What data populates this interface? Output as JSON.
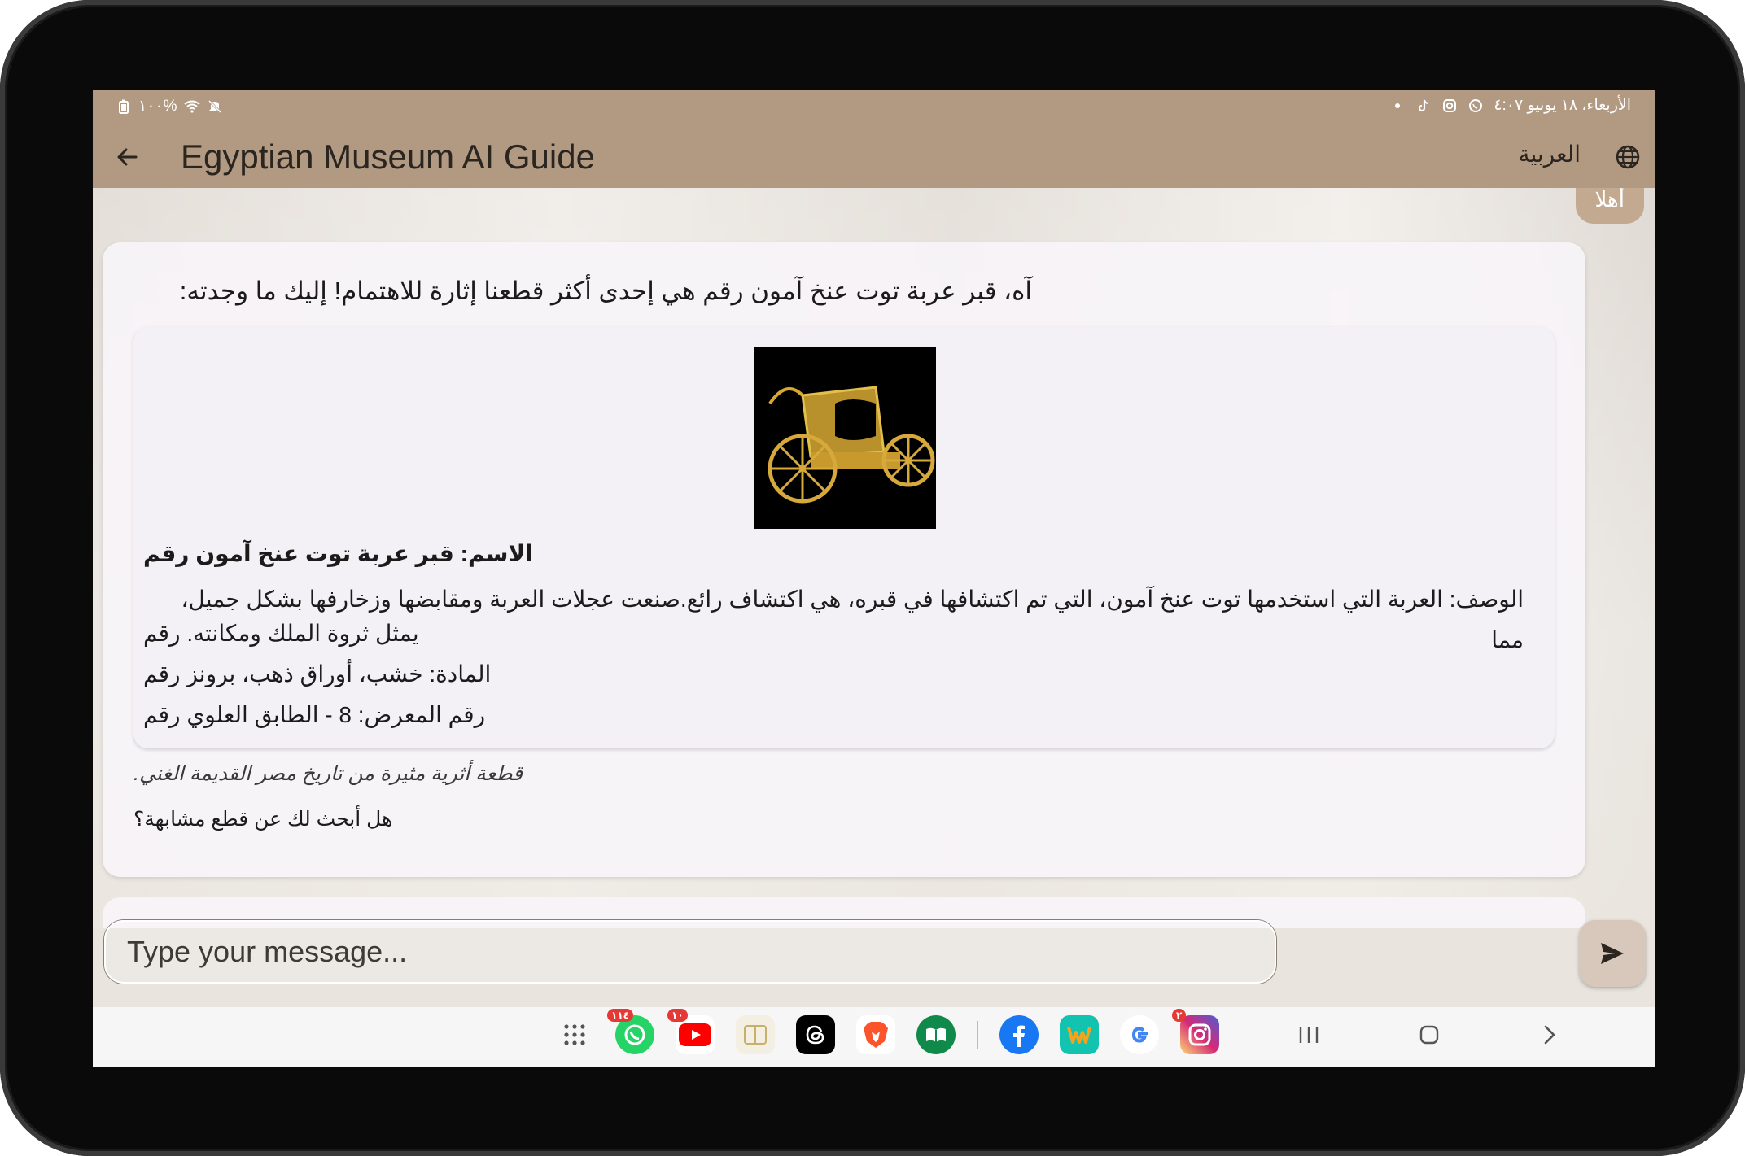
{
  "status_bar": {
    "battery": "١٠٠%",
    "datetime": "الأربعاء، ١٨ يونيو ٤:٠٧"
  },
  "app_bar": {
    "title": "Egyptian Museum AI Guide",
    "language_label": "العربية"
  },
  "chat": {
    "user_message": "أهلا",
    "ai_intro": "آه، قبر عربة توت عنخ آمون رقم  هي إحدى أكثر قطعنا إثارة للاهتمام! إليك ما وجدته:",
    "artifact": {
      "name": "الاسم: قبر عربة توت عنخ آمون رقم",
      "description_line1": "الوصف: العربة التي استخدمها توت عنخ آمون، التي تم اكتشافها في قبره، هي اكتشاف رائع.صنعت عجلات العربة ومقابضها وزخارفها بشكل جميل، مما",
      "description_line2": "يمثل ثروة الملك ومكانته. رقم",
      "material": "المادة: خشب، أوراق ذهب، برونز رقم",
      "room": "رقم المعرض: 8 - الطابق العلوي رقم"
    },
    "footnote": "قطعة أثرية مثيرة من تاريخ مصر القديمة الغني.",
    "follow_up": "هل أبحث لك عن قطع مشابهة؟"
  },
  "input": {
    "placeholder": "Type your message..."
  },
  "dock": {
    "badges": {
      "whatsapp": "١١٤",
      "youtube": "١٠",
      "instagram": "٢"
    }
  },
  "colors": {
    "app_bar": "#b29a82",
    "user_bubble": "#c3a98f",
    "card": "#f7f4f8"
  }
}
